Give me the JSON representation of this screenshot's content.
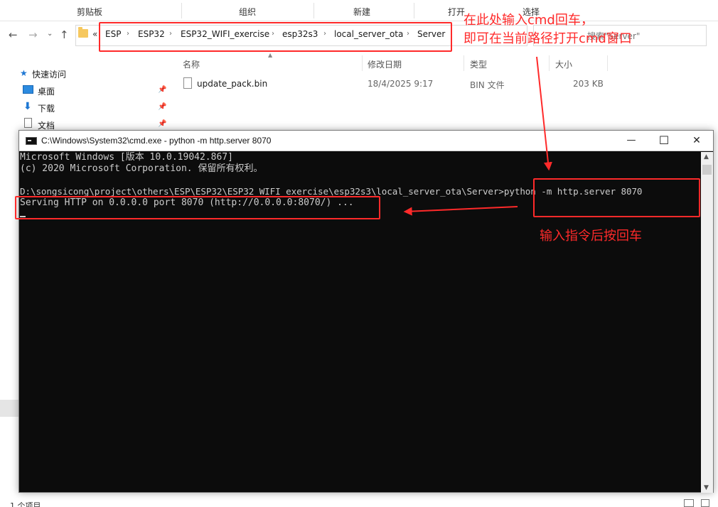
{
  "ribbon": {
    "groups": [
      "剪贴板",
      "组织",
      "新建",
      "打开",
      "选择"
    ]
  },
  "address": {
    "overflow_label": "«",
    "crumbs": [
      "ESP",
      "ESP32",
      "ESP32_WIFI_exercise",
      "esp32s3",
      "local_server_ota",
      "Server"
    ],
    "search_placeholder": "搜索\"Server\""
  },
  "sidebar": {
    "quick_access": "快速访问",
    "items": [
      "桌面",
      "下载",
      "文档"
    ]
  },
  "file_list": {
    "columns": [
      "名称",
      "修改日期",
      "类型",
      "大小"
    ],
    "files": [
      {
        "name": "update_pack.bin",
        "modified": "18/4/2025 9:17",
        "type": "BIN 文件",
        "size": "203 KB"
      }
    ]
  },
  "status_bar": {
    "item_count": "1 个项目"
  },
  "cmd_window": {
    "title": "C:\\Windows\\System32\\cmd.exe - python  -m http.server 8070",
    "minimize": "—",
    "maximize": "☐",
    "close": "✕",
    "lines": [
      "Microsoft Windows [版本 10.0.19042.867]",
      "(c) 2020 Microsoft Corporation. 保留所有权利。",
      "",
      "D:\\songsicong\\project\\others\\ESP\\ESP32\\ESP32_WIFI_exercise\\esp32s3\\local_server_ota\\Server>python -m http.server 8070",
      "Serving HTTP on 0.0.0.0 port 8070 (http://0.0.0.0:8070/) ..."
    ]
  },
  "annotations": {
    "top_note_line1": "在此处输入cmd回车，",
    "top_note_line2": "即可在当前路径打开cmd窗口",
    "bottom_note": "输入指令后按回车"
  },
  "colors": {
    "annotation": "#ff2a2a",
    "console_bg": "#0c0c0c",
    "console_text": "#cccccc"
  }
}
